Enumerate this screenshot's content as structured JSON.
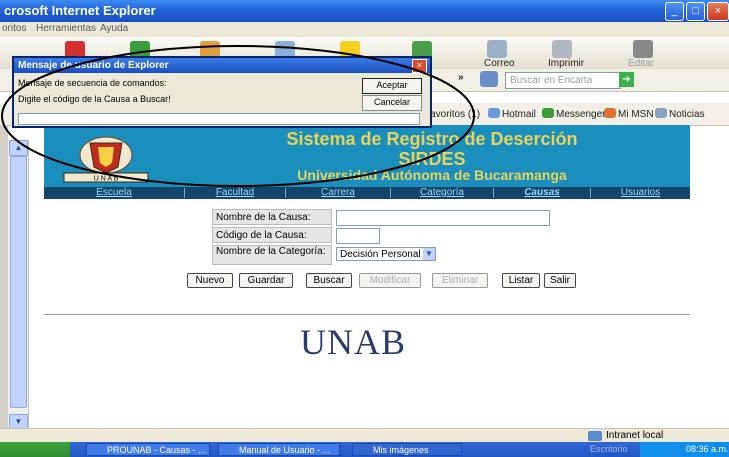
{
  "window": {
    "title": "crosoft Internet Explorer",
    "min": "_",
    "max": "□"
  },
  "menu": {
    "items": [
      "oritos",
      "Herramientas",
      "Ayuda"
    ]
  },
  "toolbar": {
    "mail_label": "Correo",
    "print_label": "Imprimir",
    "edit_label": "Editar",
    "search_placeholder": "Buscar en Encarta",
    "favorites_label": "Favoritos (1)",
    "hotmail_label": "Hotmail",
    "messenger_label": "Messenger",
    "mimsn_label": "Mi MSN",
    "news_label": "Noticias",
    "chevron": "»"
  },
  "dialog": {
    "title": "Mensaje de usuario de Explorer",
    "message1": "Mensaje de secuencia de comandos:",
    "message2": "Digite el código de la Causa a Buscar!",
    "ok_label": "Aceptar",
    "cancel_label": "Cancelar",
    "input_value": ""
  },
  "banner": {
    "title": "Sistema de Registro de Deserción",
    "subtitle": "SIRDES",
    "university": "Universidad Autónoma de Bucaramanga",
    "logo_text": "U N A B"
  },
  "nav": {
    "items": [
      "Escuela",
      "Facultad",
      "Carrera",
      "Categoría",
      "Causas",
      "Usuarios"
    ]
  },
  "form": {
    "name_label": "Nombre de la Causa:",
    "name_value": "",
    "code_label": "Código de la Causa:",
    "code_value": "",
    "category_label": "Nombre de la Categoría:",
    "category_value": "Decisión Personal"
  },
  "buttons": {
    "new": "Nuevo",
    "save": "Guardar",
    "search": "Buscar",
    "modify": "Modificar",
    "delete": "Eliminar",
    "list": "Listar",
    "exit": "Salir"
  },
  "footer": {
    "brand": "UNAB"
  },
  "statusbar": {
    "zone": "Intranet local"
  },
  "taskbar": {
    "tasks": [
      "PROUNAB - Causas - ...",
      "Manual de Usuario - ...",
      "Mis imágenes"
    ],
    "desktop": "Escritorio",
    "clock": "08:36 a.m."
  },
  "colors": {
    "banner": "#1a8fbd",
    "title_text": "#e8d45a",
    "nav_bg": "#13446c",
    "ellipse": "#000000"
  }
}
